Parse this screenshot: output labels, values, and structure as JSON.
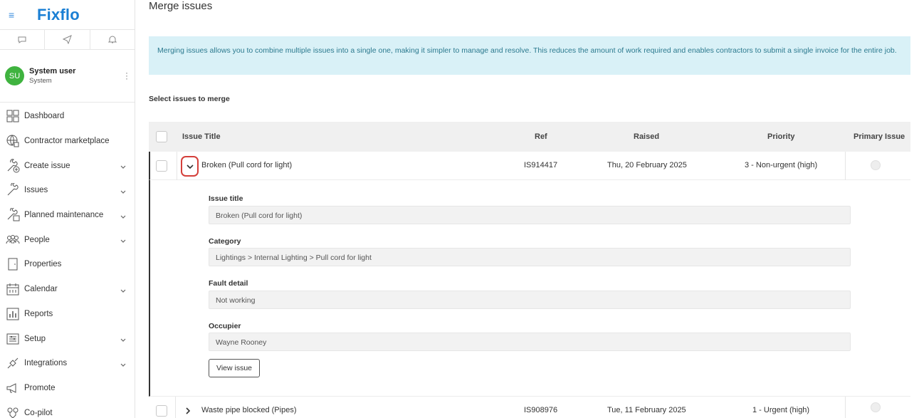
{
  "brand": {
    "logo": "Fixflo"
  },
  "user": {
    "initials": "SU",
    "name": "System user",
    "role": "System"
  },
  "nav": [
    {
      "label": "Dashboard",
      "icon": "dashboard-icon",
      "chevron": false
    },
    {
      "label": "Contractor marketplace",
      "icon": "globe-icon",
      "chevron": false
    },
    {
      "label": "Create issue",
      "icon": "wrench-plus-icon",
      "chevron": true
    },
    {
      "label": "Issues",
      "icon": "wrench-icon",
      "chevron": true
    },
    {
      "label": "Planned maintenance",
      "icon": "wrench-calendar-icon",
      "chevron": true
    },
    {
      "label": "People",
      "icon": "people-icon",
      "chevron": true
    },
    {
      "label": "Properties",
      "icon": "door-icon",
      "chevron": false
    },
    {
      "label": "Calendar",
      "icon": "calendar-icon",
      "chevron": true
    },
    {
      "label": "Reports",
      "icon": "bar-chart-icon",
      "chevron": false
    },
    {
      "label": "Setup",
      "icon": "sliders-icon",
      "chevron": true
    },
    {
      "label": "Integrations",
      "icon": "plug-icon",
      "chevron": true
    },
    {
      "label": "Promote",
      "icon": "megaphone-icon",
      "chevron": false
    },
    {
      "label": "Co-pilot",
      "icon": "copilot-icon",
      "chevron": false
    }
  ],
  "page": {
    "title": "Merge issues",
    "info": "Merging issues allows you to combine multiple issues into a single one, making it simpler to manage and resolve. This reduces the amount of work required and enables contractors to submit a single invoice for the entire job.",
    "section_label": "Select issues to merge"
  },
  "table": {
    "headers": {
      "title": "Issue Title",
      "ref": "Ref",
      "raised": "Raised",
      "priority": "Priority",
      "primary": "Primary Issue"
    },
    "rows": [
      {
        "title": "Broken (Pull cord for light)",
        "ref": "IS914417",
        "raised": "Thu, 20 February 2025",
        "priority": "3 - Non-urgent (high)"
      },
      {
        "title": "Waste pipe blocked (Pipes)",
        "ref": "IS908976",
        "raised": "Tue, 11 February 2025",
        "priority": "1 - Urgent (high)"
      }
    ]
  },
  "details": {
    "issue_title_label": "Issue title",
    "issue_title_value": "Broken (Pull cord for light)",
    "category_label": "Category",
    "category_value": "Lightings > Internal Lighting > Pull cord for light",
    "fault_label": "Fault detail",
    "fault_value": "Not working",
    "occupier_label": "Occupier",
    "occupier_value": "Wayne Rooney",
    "view_button": "View issue"
  }
}
